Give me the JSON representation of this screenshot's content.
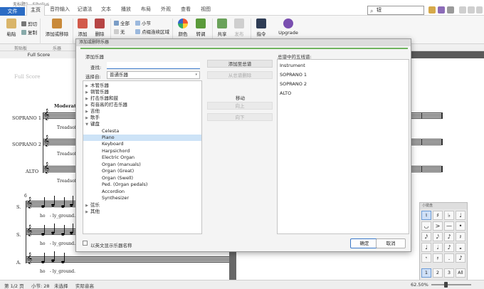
{
  "app": {
    "title": "无标题1 - Sibelius"
  },
  "ribbon_tabs": [
    "文件",
    "主页",
    "音符输入",
    "记谱法",
    "文本",
    "播放",
    "布局",
    "外观",
    "查看",
    "视图"
  ],
  "active_tab": "主页",
  "search": {
    "value": "钮"
  },
  "ribbon": {
    "paste": "粘贴",
    "cut": "剪切",
    "copy": "复制",
    "add_remove": "添加或移除",
    "add": "添加",
    "delete": "删除",
    "all": "全部",
    "none": "无",
    "bar": "小节",
    "passage": "点缀连续区域",
    "color": "颜色",
    "transpose": "转调",
    "share": "共享",
    "publish": "发布",
    "command": "指令",
    "upgrade": "Upgrade"
  },
  "ribbon_groups": {
    "clipboard": "剪贴板",
    "instruments": "乐器"
  },
  "document_tab": "Full Score",
  "score": {
    "title": "Full Score",
    "tempo": "Moderato",
    "instruments": [
      "SOPRANO 1",
      "SOPRANO 2",
      "ALTO"
    ],
    "lyric_tread": "Tread",
    "lyric_soft": "soft",
    "system2_number": "6",
    "system2_labels": [
      "S.",
      "S.",
      "A."
    ],
    "lyric_ho": "ho",
    "lyric_ground": "-  ly_ground."
  },
  "dialog": {
    "title": "添加或删除乐器",
    "section_add": "添加乐器",
    "find_label": "查找:",
    "find_value": "",
    "choose_from_label": "选择自:",
    "choose_from_value": "普通乐器",
    "tree": [
      {
        "label": "木管乐器",
        "expanded": false
      },
      {
        "label": "铜管乐器",
        "expanded": false
      },
      {
        "label": "打击乐器和鼓",
        "expanded": false
      },
      {
        "label": "有音高的打击乐器",
        "expanded": false
      },
      {
        "label": "吉他",
        "expanded": false
      },
      {
        "label": "歌手",
        "expanded": false
      },
      {
        "label": "键盘",
        "expanded": true
      }
    ],
    "keyboard_children": [
      "Celesta",
      "Piano",
      "Keyboard",
      "Harpsichord",
      "Electric Organ",
      "Organ (manuals)",
      "Organ (Great)",
      "Organ (Swell)",
      "Ped. (Organ pedals)",
      "Accordion",
      "Synthesizer"
    ],
    "selected_child": "Piano",
    "tree_after": [
      {
        "label": "弦乐",
        "expanded": false
      },
      {
        "label": "其他",
        "expanded": false
      }
    ],
    "add_to_score": "添加至总谱",
    "remove_from_score": "从总谱删除",
    "move_label": "移动",
    "up": "向上",
    "down": "向下",
    "staves_header": "总谱中的五线谱:",
    "staves": [
      "Instrument",
      "SOPRANO 1",
      "SOPRANO 2",
      "ALTO"
    ],
    "english_names": "以英文显示乐器名称",
    "ok": "确定",
    "cancel": "取消"
  },
  "keypad": {
    "title": "小键盘",
    "rows": [
      [
        "♮",
        "♯",
        "♭",
        "♩"
      ],
      [
        "◡",
        ">",
        "—",
        "•"
      ],
      [
        "𝅘𝅥𝅯",
        "𝅘𝅥𝅮",
        "♪",
        "𝄽"
      ],
      [
        "♩",
        "𝅗𝅥",
        "♪",
        "𝅝"
      ],
      [
        "𝄾",
        "𝄿",
        ".",
        "♪"
      ]
    ],
    "tabs": [
      "1",
      "2",
      "3",
      "All"
    ]
  },
  "status": {
    "page": "第 1/2 页",
    "bar": "小节: 28",
    "selection": "未选择",
    "pitch": "实际音高",
    "zoom": "62.50%"
  },
  "colors": {
    "accent": "#2b6cc4",
    "selection": "#cde3f7",
    "green_strip": "#6fb35e"
  }
}
